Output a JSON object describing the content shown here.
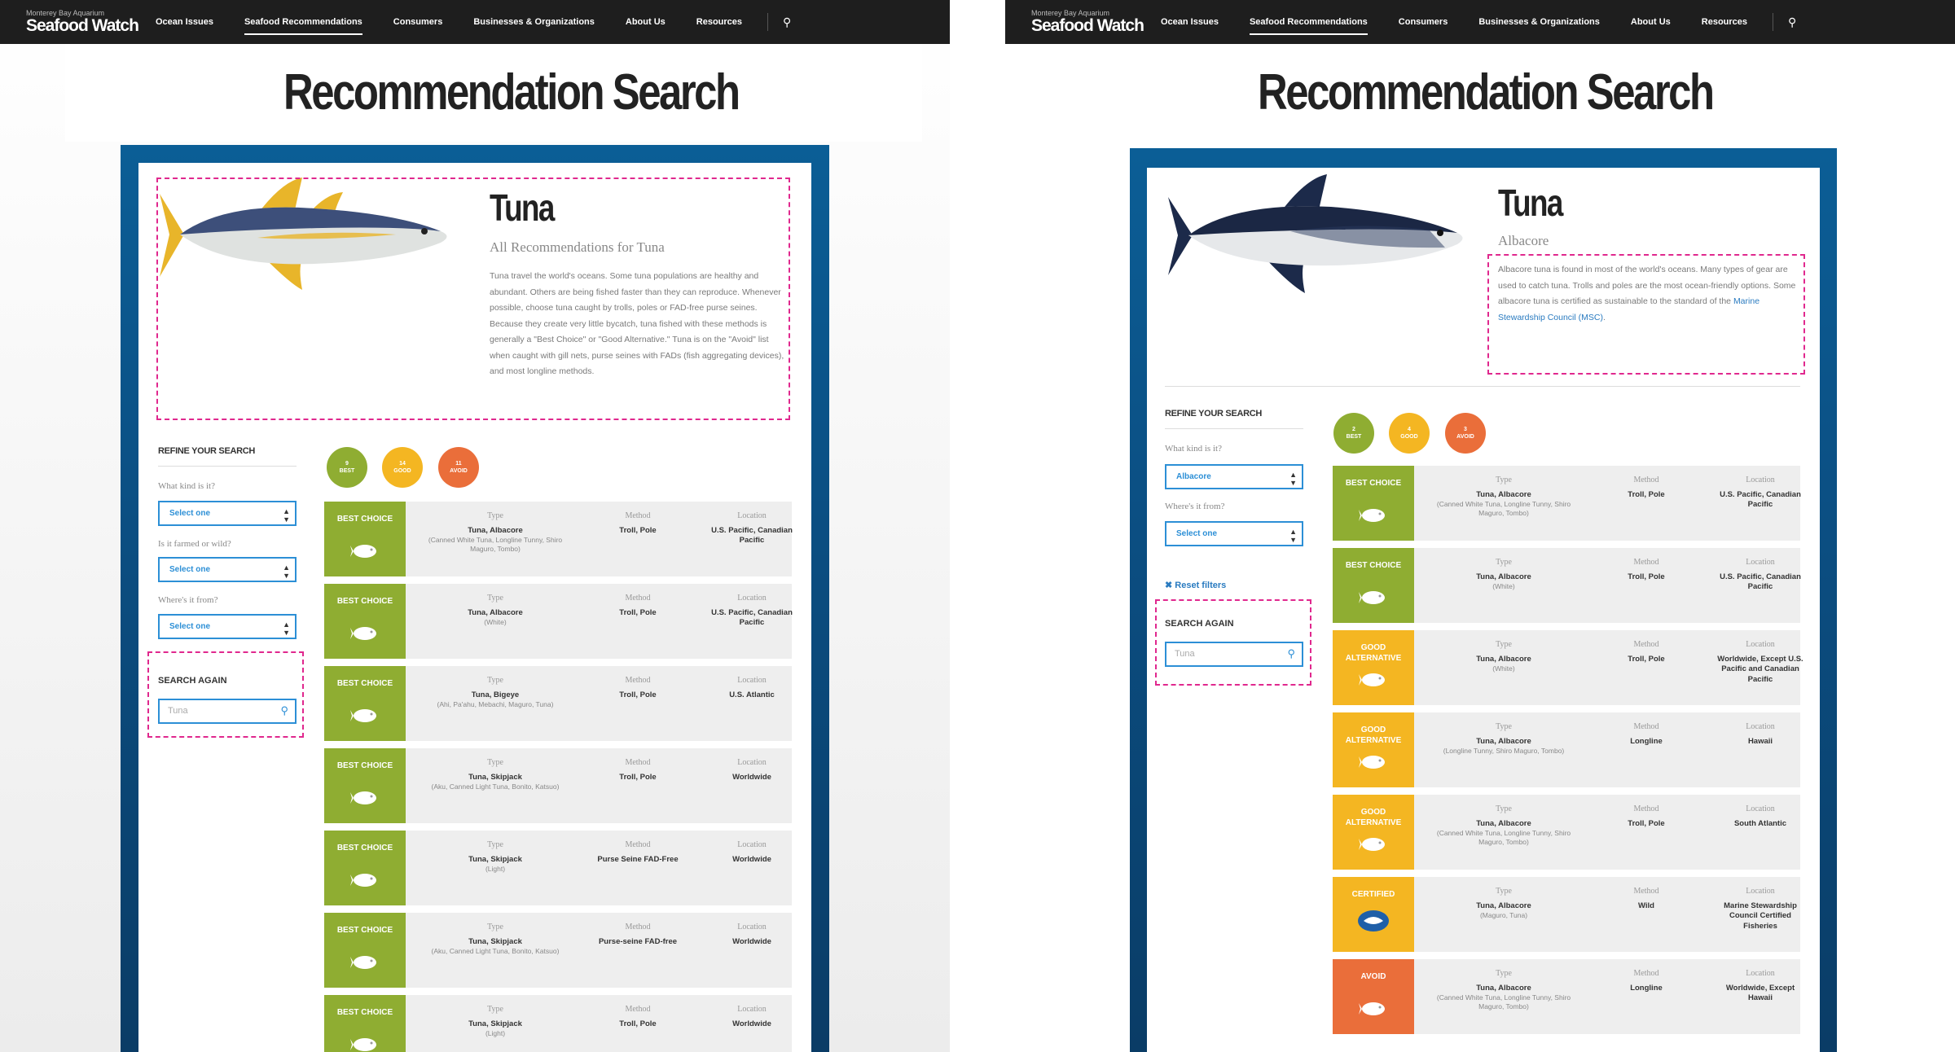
{
  "nav": {
    "logo_small": "Monterey Bay Aquarium",
    "logo_big": "Seafood Watch",
    "items": [
      "Ocean Issues",
      "Seafood Recommendations",
      "Consumers",
      "Businesses & Organizations",
      "About Us",
      "Resources"
    ],
    "active_item": "Seafood Recommendations",
    "search_icon": "search-icon"
  },
  "page_title": "Recommendation Search",
  "left": {
    "species": {
      "name": "Tuna",
      "subtitle": "All Recommendations for Tuna",
      "description": "Tuna travel the world's oceans. Some tuna populations are healthy and abundant. Others are being fished faster than they can reproduce. Whenever possible, choose tuna caught by trolls, poles or FAD-free purse seines. Because they create very little bycatch, tuna fished with these methods is generally a \"Best Choice\" or \"Good Alternative.\" Tuna is on the \"Avoid\" list when caught with gill nets, purse seines with FADs (fish aggregating devices), and most longline methods."
    },
    "refine": {
      "title": "REFINE YOUR SEARCH",
      "fields": [
        {
          "label": "What kind is it?",
          "value": "Select one"
        },
        {
          "label": "Is it farmed or wild?",
          "value": "Select one"
        },
        {
          "label": "Where's it from?",
          "value": "Select one"
        }
      ]
    },
    "search_again": {
      "title": "SEARCH AGAIN",
      "placeholder": "Tuna"
    },
    "counts": [
      {
        "num": "9",
        "label": "BEST"
      },
      {
        "num": "14",
        "label": "GOOD"
      },
      {
        "num": "11",
        "label": "AVOID"
      }
    ],
    "rows": [
      {
        "rating": "BEST CHOICE",
        "type": "Tuna, Albacore",
        "type_note": "(Canned White Tuna, Longline Tunny, Shiro Maguro, Tombo)",
        "method": "Troll, Pole",
        "location": "U.S. Pacific, Canadian Pacific"
      },
      {
        "rating": "BEST CHOICE",
        "type": "Tuna, Albacore",
        "type_note": "(White)",
        "method": "Troll, Pole",
        "location": "U.S. Pacific, Canadian Pacific"
      },
      {
        "rating": "BEST CHOICE",
        "type": "Tuna, Bigeye",
        "type_note": "(Ahi, Pa'ahu, Mebachi, Maguro, Tuna)",
        "method": "Troll, Pole",
        "location": "U.S. Atlantic"
      },
      {
        "rating": "BEST CHOICE",
        "type": "Tuna, Skipjack",
        "type_note": "(Aku, Canned Light Tuna, Bonito, Katsuo)",
        "method": "Troll, Pole",
        "location": "Worldwide"
      },
      {
        "rating": "BEST CHOICE",
        "type": "Tuna, Skipjack",
        "type_note": "(Light)",
        "method": "Purse Seine FAD-Free",
        "location": "Worldwide"
      },
      {
        "rating": "BEST CHOICE",
        "type": "Tuna, Skipjack",
        "type_note": "(Aku, Canned Light Tuna, Bonito, Katsuo)",
        "method": "Purse-seine FAD-free",
        "location": "Worldwide"
      },
      {
        "rating": "BEST CHOICE",
        "type": "Tuna, Skipjack",
        "type_note": "(Light)",
        "method": "Troll, Pole",
        "location": "Worldwide"
      }
    ]
  },
  "right": {
    "species": {
      "name": "Tuna",
      "subtitle": "Albacore",
      "description": "Albacore tuna is found in most of the world's oceans. Many types of gear are used to catch tuna. Trolls and poles are the most ocean-friendly options. Some albacore tuna is certified as sustainable to the standard of the",
      "link": "Marine Stewardship Council (MSC)",
      "end": "."
    },
    "refine": {
      "title": "REFINE YOUR SEARCH",
      "fields": [
        {
          "label": "What kind is it?",
          "value": "Albacore"
        },
        {
          "label": "Where's it from?",
          "value": "Select one"
        }
      ]
    },
    "reset": "Reset filters",
    "search_again": {
      "title": "SEARCH AGAIN",
      "placeholder": "Tuna"
    },
    "counts": [
      {
        "num": "2",
        "label": "BEST"
      },
      {
        "num": "4",
        "label": "GOOD"
      },
      {
        "num": "3",
        "label": "AVOID"
      }
    ],
    "rows": [
      {
        "rating": "BEST CHOICE",
        "class": "b-best",
        "type": "Tuna, Albacore",
        "type_note": "(Canned White Tuna, Longline Tunny, Shiro Maguro, Tombo)",
        "method": "Troll, Pole",
        "location": "U.S. Pacific, Canadian Pacific"
      },
      {
        "rating": "BEST CHOICE",
        "class": "b-best",
        "type": "Tuna, Albacore",
        "type_note": "(White)",
        "method": "Troll, Pole",
        "location": "U.S. Pacific, Canadian Pacific"
      },
      {
        "rating": "GOOD ALTERNATIVE",
        "class": "b-good",
        "type": "Tuna, Albacore",
        "type_note": "(White)",
        "method": "Troll, Pole",
        "location": "Worldwide, Except U.S. Pacific and Canadian Pacific"
      },
      {
        "rating": "GOOD ALTERNATIVE",
        "class": "b-good",
        "type": "Tuna, Albacore",
        "type_note": "(Longline Tunny, Shiro Maguro, Tombo)",
        "method": "Longline",
        "location": "Hawaii"
      },
      {
        "rating": "GOOD ALTERNATIVE",
        "class": "b-good",
        "type": "Tuna, Albacore",
        "type_note": "(Canned White Tuna, Longline Tunny, Shiro Maguro, Tombo)",
        "method": "Troll, Pole",
        "location": "South Atlantic"
      },
      {
        "rating": "CERTIFIED",
        "class": "b-cert",
        "type": "Tuna, Albacore",
        "type_note": "(Maguro, Tuna)",
        "method": "Wild",
        "location": "Marine Stewardship Council Certified Fisheries"
      },
      {
        "rating": "AVOID",
        "class": "b-avoid",
        "type": "Tuna, Albacore",
        "type_note": "(Canned White Tuna, Longline Tunny, Shiro Maguro, Tombo)",
        "method": "Longline",
        "location": "Worldwide, Except Hawaii"
      }
    ]
  },
  "labels": {
    "type": "Type",
    "method": "Method",
    "location": "Location"
  }
}
